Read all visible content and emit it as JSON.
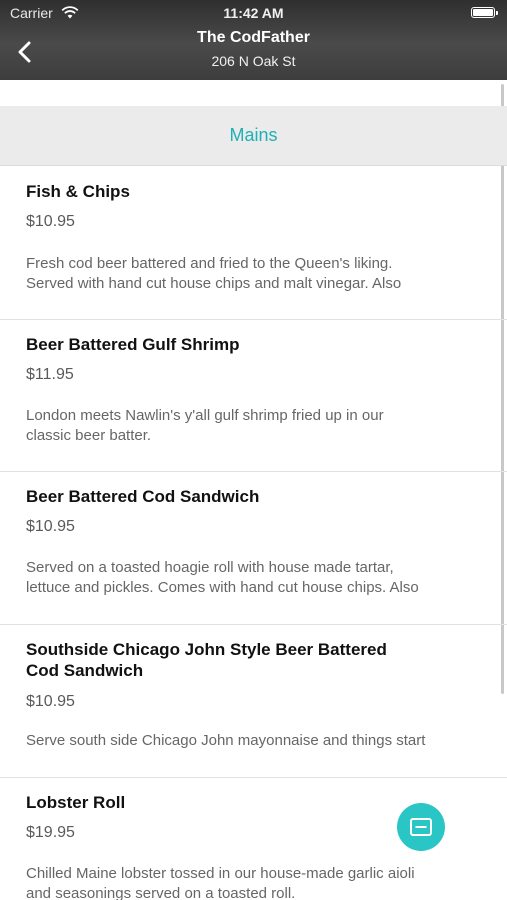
{
  "status_bar": {
    "carrier": "Carrier",
    "time": "11:42 AM"
  },
  "nav": {
    "title": "The CodFather",
    "subtitle": "206 N Oak St"
  },
  "section": {
    "title": "Mains"
  },
  "menu_items": [
    {
      "name": "Fish & Chips",
      "price": "$10.95",
      "desc_line1": "Fresh cod beer battered and fried to the Queen's liking.",
      "desc_line2": "Served with hand cut house chips and malt vinegar. Also"
    },
    {
      "name": "Beer Battered Gulf Shrimp",
      "price": "$11.95",
      "desc_line1": "London meets Nawlin's y'all gulf shrimp fried up in our",
      "desc_line2": "classic beer batter."
    },
    {
      "name": "Beer Battered Cod Sandwich",
      "price": "$10.95",
      "desc_line1": "Served on a toasted hoagie roll with house made tartar,",
      "desc_line2": "lettuce and pickles. Comes with hand cut house chips. Also"
    },
    {
      "name_line1": "Southside Chicago John Style Beer Battered",
      "name_line2": "Cod Sandwich",
      "price": "$10.95",
      "desc_line1": "Serve south side Chicago John mayonnaise and things start"
    },
    {
      "name": "Lobster Roll",
      "price": "$19.95",
      "desc_line1": "Chilled Maine lobster tossed in our house-made garlic aioli",
      "desc_line2": "and seasonings served on a toasted roll."
    }
  ],
  "colors": {
    "accent": "#1fb1b4",
    "chat_button": "#2ac6c6",
    "header": "#3d3d3d"
  },
  "icons": {
    "back": "chevron-left-icon",
    "chat": "chat-icon",
    "wifi": "wifi-icon",
    "battery": "battery-icon"
  }
}
